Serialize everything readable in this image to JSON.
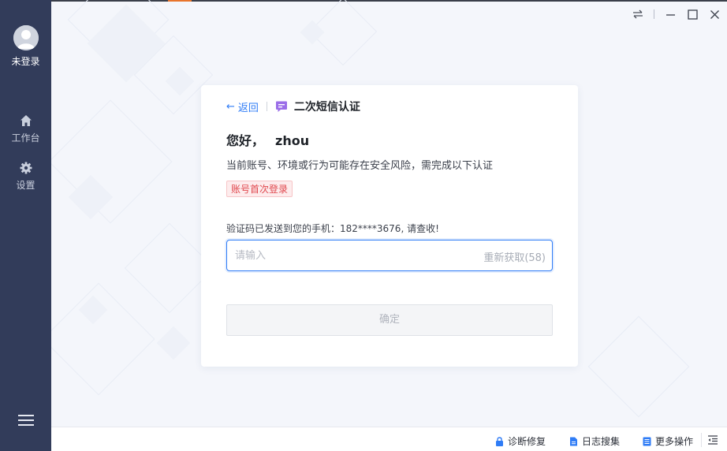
{
  "sidebar": {
    "user_label": "未登录",
    "items": [
      {
        "label": "工作台",
        "icon": "home-icon"
      },
      {
        "label": "设置",
        "icon": "gear-icon"
      }
    ],
    "menu_icon": "hamburger-icon"
  },
  "window_controls": [
    "swap-icon",
    "minimize-icon",
    "maximize-icon",
    "close-icon"
  ],
  "card": {
    "back_label": "返回",
    "title": "二次短信认证",
    "greeting": "您好，",
    "username": "zhou",
    "description": "当前账号、环境或行为可能存在安全风险，需完成以下认证",
    "tag": "账号首次登录",
    "sent_info": "验证码已发送到您的手机：182****3676, 请查收!",
    "code_placeholder": "请输入",
    "code_value": "",
    "resend_label": "重新获取(58)",
    "confirm_label": "确定"
  },
  "statusbar": {
    "diagnose": "诊断修复",
    "log": "日志搜集",
    "more": "更多操作"
  },
  "colors": {
    "sidebar_bg": "#323c5a",
    "accent": "#2f7cf6",
    "tag_red": "#e0484e",
    "sms_icon_purple": "#9b6ee8"
  }
}
